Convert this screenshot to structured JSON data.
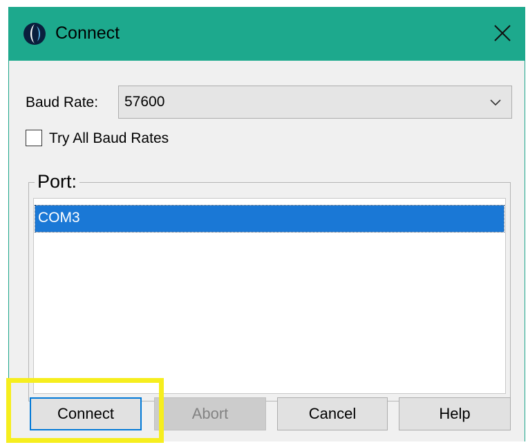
{
  "window": {
    "title": "Connect",
    "icon": "app-logo-icon",
    "close_icon": "close-icon",
    "titlebar_color": "#1da98d"
  },
  "form": {
    "baud_rate_label": "Baud Rate:",
    "baud_rate_value": "57600",
    "baud_rate_dropdown_icon": "chevron-down-icon",
    "try_all_label": "Try All Baud Rates",
    "try_all_checked": false
  },
  "port": {
    "group_label": "Port:",
    "items": [
      {
        "label": "COM3",
        "selected": true
      }
    ],
    "selection_color": "#1a78d6"
  },
  "buttons": {
    "connect": "Connect",
    "abort": "Abort",
    "cancel": "Cancel",
    "help": "Help",
    "abort_enabled": false
  },
  "annotation": {
    "highlight_target": "connect-button",
    "highlight_color": "#f6ee1e"
  }
}
